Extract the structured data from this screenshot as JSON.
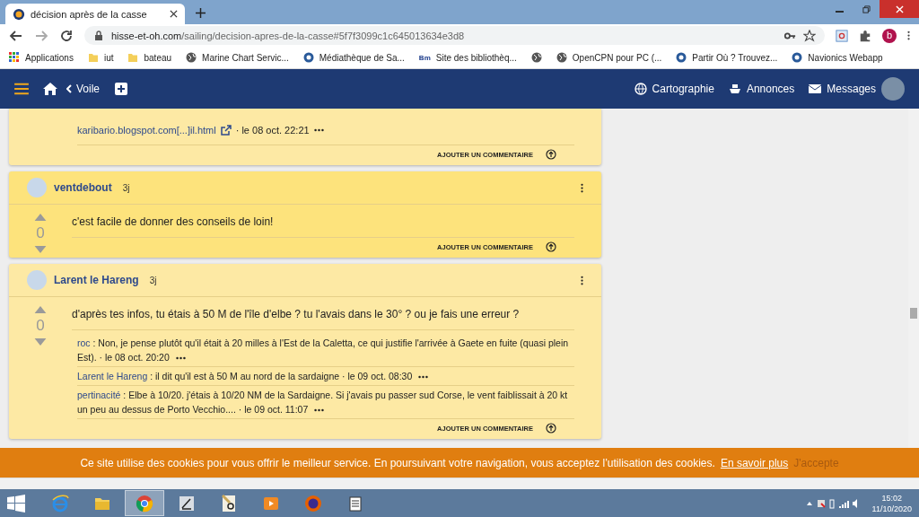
{
  "browser": {
    "tab_title": "décision après de la casse",
    "url_host": "hisse-et-oh.com",
    "url_path": "/sailing/decision-apres-de-la-casse#5f7f3099c1c645013634e3d8",
    "profile_initial": "b",
    "bookmarks": [
      {
        "label": "Applications",
        "kind": "apps"
      },
      {
        "label": "iut",
        "kind": "folder"
      },
      {
        "label": "bateau",
        "kind": "folder"
      },
      {
        "label": "Marine Chart Servic...",
        "kind": "globe"
      },
      {
        "label": "Médiathèque de Sa...",
        "kind": "site"
      },
      {
        "label": "Site des bibliothèq...",
        "kind": "bm",
        "icon_text": "Bm"
      },
      {
        "kind": "globe"
      },
      {
        "label": "OpenCPN pour PC (...",
        "kind": "globe"
      },
      {
        "label": "Partir Où ? Trouvez...",
        "kind": "site"
      },
      {
        "label": "Navionics Webapp",
        "kind": "site"
      }
    ]
  },
  "nav": {
    "back_label": "Voile",
    "links": [
      {
        "label": "Cartographie",
        "kind": "globe"
      },
      {
        "label": "Annonces",
        "kind": "boat"
      },
      {
        "label": "Messages",
        "kind": "mail"
      }
    ]
  },
  "cards": [
    {
      "highlighted": false,
      "comments": [
        {
          "kind": "link",
          "link": "karibario.blogspot.com[...]il.html",
          "time": "· le 08 oct. 22:21"
        }
      ],
      "add_comment": "AJOUTER UN COMMENTAIRE"
    },
    {
      "highlighted": true,
      "header": {
        "author": "ventdebout",
        "age": "3j"
      },
      "body": "c'est facile de donner des conseils de loin!",
      "votes": "0",
      "add_comment": "AJOUTER UN COMMENTAIRE"
    },
    {
      "highlighted": false,
      "header": {
        "author": "Larent le Hareng",
        "age": "3j"
      },
      "body": "d'après tes infos, tu étais à 50 M de l'île d'elbe ? tu l'avais dans le 30° ? ou je fais une erreur ?",
      "votes": "0",
      "comments": [
        {
          "kind": "text",
          "author": "roc",
          "text": ": Non, je pense plutôt qu'il était à 20 milles à l'Est de la Caletta, ce qui justifie l'arrivée à Gaete en fuite (quasi plein Est).",
          "time": "· le 08 oct. 20:20"
        },
        {
          "kind": "text",
          "author": "Larent le Hareng",
          "text": ": il dit qu'il est à 50 M au nord de la sardaigne",
          "time": "· le 09 oct. 08:30"
        },
        {
          "kind": "text",
          "author": "pertinacité",
          "text": ": Elbe à 10/20. j'étais à 10/20 NM de la Sardaigne. Si j'avais pu passer sud Corse, le vent faiblissait à 20 kt un peu au dessus de Porto Vecchio....",
          "time": "· le 09 oct. 11:07"
        }
      ],
      "add_comment": "AJOUTER UN COMMENTAIRE"
    }
  ],
  "cookie_bar": {
    "text": "Ce site utilise des cookies pour vous offrir le meilleur service. En poursuivant votre navigation, vous acceptez l’utilisation des cookies.",
    "more_link": "En savoir plus",
    "accept": "J'accepte"
  },
  "taskbar": {
    "apps": [
      {
        "kind": "ie",
        "selected": false
      },
      {
        "kind": "explorer",
        "selected": false
      },
      {
        "kind": "chrome",
        "selected": true
      },
      {
        "kind": "pen",
        "selected": false
      },
      {
        "kind": "doc",
        "selected": false
      },
      {
        "kind": "media",
        "selected": false
      },
      {
        "kind": "firefox",
        "selected": false
      },
      {
        "kind": "files",
        "selected": false
      }
    ],
    "time": "15:02",
    "date": "11/10/2020"
  }
}
